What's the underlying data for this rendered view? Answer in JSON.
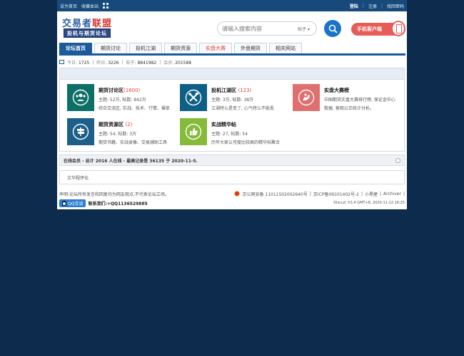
{
  "topbar": {
    "set_home": "设为首页",
    "bookmark": "收藏本站",
    "login": "登陆",
    "register": "注册",
    "find_password": "找回密码"
  },
  "logo": {
    "main_blue": "交易者",
    "main_red": "联盟",
    "sub": "投机与期货论坛"
  },
  "search": {
    "placeholder": "请输入搜索内容",
    "type": "帖子 ▾"
  },
  "mobile_client": "手机客户端",
  "nav": {
    "tabs": [
      "论坛首页",
      "期货讨论",
      "投机江湖",
      "期货资源",
      "实盘大赛",
      "外盘期货",
      "相关网站"
    ]
  },
  "stats": {
    "today_label": "今日:",
    "today": "1725",
    "yesterday_label": "昨日:",
    "yesterday": "3226",
    "posts_label": "帖子:",
    "posts": "8841982",
    "members_label": "会员:",
    "members": "201588"
  },
  "forums": [
    {
      "name": "期货讨论区",
      "count": "(1600)",
      "meta": "主题: 52万, 帖数: 842万",
      "desc": "综合交流区, 实战、技术、行情、裸单",
      "color": "#0e6f66",
      "icon": "group-icon"
    },
    {
      "name": "投机江湖区",
      "count": "(123)",
      "meta": "主题: 3万, 帖数: 38万",
      "desc": "江湖特么是变了, 心气特么不能丢",
      "color": "#0e5f86",
      "icon": "tools-icon"
    },
    {
      "name": "实盘大赛榜",
      "count": "",
      "meta": "中国期货实盘大赛排行榜, 保证金中心",
      "desc": "数据, 客观公正统计分析。",
      "color": "#e07070",
      "icon": "horse-icon"
    },
    {
      "name": "期货资源区",
      "count": "(2)",
      "meta": "主题: 54, 帖数: 3万",
      "desc": "期货书籍、实战录像、交易辅助工具",
      "color": "#1c5f88",
      "icon": "signpost-icon"
    },
    {
      "name": "实战精华帖",
      "count": "",
      "meta": "主题: 27, 帖数: 54",
      "desc": "历年大家认可度比较高的精华帖聚合",
      "color": "#86bb3a",
      "icon": "thumbs-up-icon"
    }
  ],
  "online": "在线会员 - 总计 2016 人在线 - 最高记录是 36135 于 2020-11-5.",
  "friendlinks": "文华程序化",
  "footer": {
    "disclaimer": "声明:论坛所有发言和回复均为网友观点,不代表论坛立场。",
    "police": "京公网安备 11011502002640号",
    "icp": "京ICP备09101402号-2",
    "small_dark": "小黑屋",
    "archiver": "Archiver",
    "qq_btn": "QQ交谈",
    "contact": "联系我们:+QQ1136529885",
    "powered": "Discuz! X3.4 GMT+8, 2020-11-12 16:25"
  },
  "colors": {
    "topbar": "#174a7a",
    "nav_active": "#1b5b9a",
    "accent_red": "#e0423b",
    "background": "#0d2b4d"
  }
}
